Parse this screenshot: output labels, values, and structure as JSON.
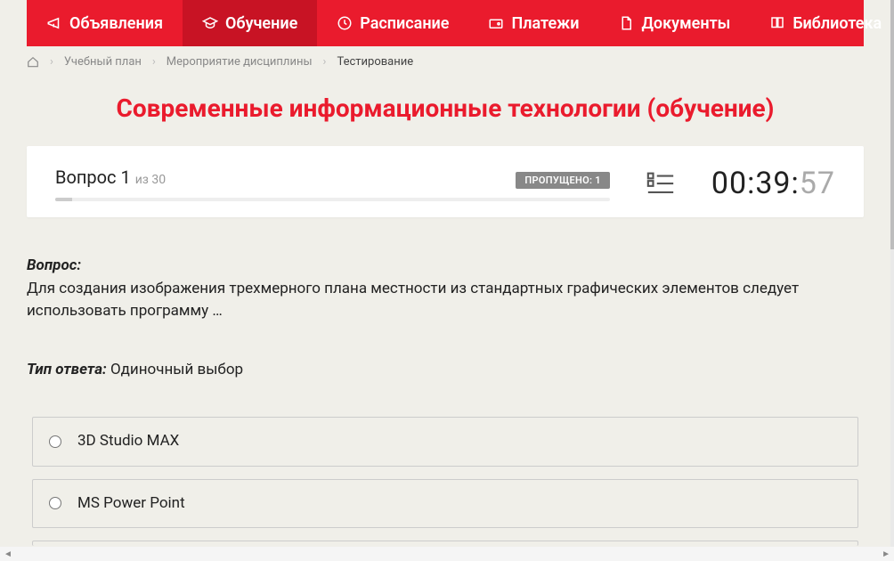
{
  "nav": {
    "items": [
      {
        "label": "Объявления"
      },
      {
        "label": "Обучение"
      },
      {
        "label": "Расписание"
      },
      {
        "label": "Платежи"
      },
      {
        "label": "Документы"
      },
      {
        "label": "Библиотека"
      }
    ]
  },
  "breadcrumb": {
    "items": [
      {
        "label": "Учебный план"
      },
      {
        "label": "Мероприятие дисциплины"
      },
      {
        "label": "Тестирование"
      }
    ]
  },
  "page_title": "Современные информационные технологии (обучение)",
  "status": {
    "question_label": "Вопрос",
    "question_num": "1",
    "of_label": "из",
    "total": "30",
    "skipped_label": "ПРОПУЩЕНО: 1",
    "timer_main": "00:39:",
    "timer_sec": "57"
  },
  "question": {
    "q_label": "Вопрос:",
    "q_text": "Для создания изображения трехмерного плана местности из стандартных графических элементов следует использовать программу …",
    "a_label": "Тип ответа:",
    "a_type": "Одиночный выбор"
  },
  "options": [
    {
      "label": "3D Studio MAX"
    },
    {
      "label": "MS Power Point"
    }
  ]
}
